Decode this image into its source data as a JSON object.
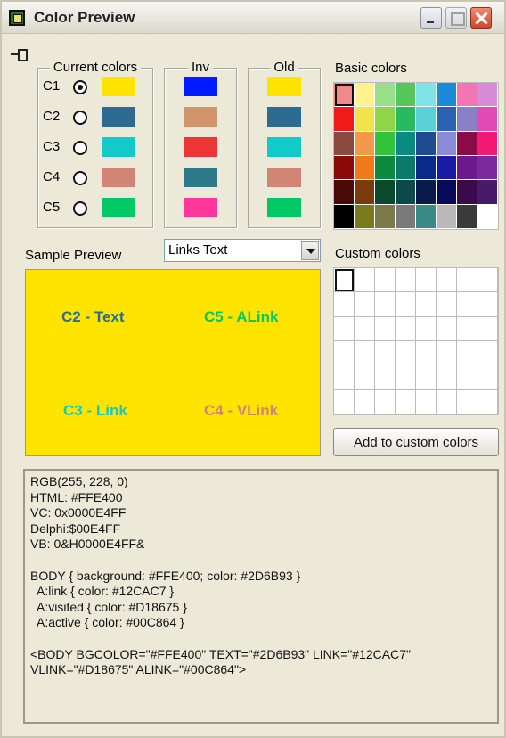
{
  "window": {
    "title": "Color Preview"
  },
  "current_colors": {
    "legend": "Current colors",
    "rows": [
      {
        "label": "C1",
        "selected": true,
        "color": "#FFE400"
      },
      {
        "label": "C2",
        "selected": false,
        "color": "#2D6B93"
      },
      {
        "label": "C3",
        "selected": false,
        "color": "#12CAC7"
      },
      {
        "label": "C4",
        "selected": false,
        "color": "#D18675"
      },
      {
        "label": "C5",
        "selected": false,
        "color": "#00C864"
      }
    ]
  },
  "inv_colors": {
    "legend": "Inv",
    "colors": [
      "#001BFF",
      "#D2946C",
      "#ED3538",
      "#2E798A",
      "#FF379B"
    ]
  },
  "old_colors": {
    "legend": "Old",
    "colors": [
      "#FFE400",
      "#2D6B93",
      "#12CAC7",
      "#D18675",
      "#00C864"
    ]
  },
  "basic_colors": {
    "label": "Basic colors",
    "colors": [
      "#F08A8A",
      "#FFF38F",
      "#98E08A",
      "#54C65A",
      "#7FE3E8",
      "#1B8AD8",
      "#F276B4",
      "#D98BD8",
      "#F01A1A",
      "#F3E34A",
      "#8CD648",
      "#29B95E",
      "#5AD0D8",
      "#2A61B4",
      "#8A80C6",
      "#E24AB6",
      "#8A4A40",
      "#F39A4A",
      "#33C33A",
      "#0A8A82",
      "#1F4A8F",
      "#8A8AD8",
      "#8A0A4A",
      "#F21A72",
      "#8A0A0A",
      "#F07A1A",
      "#0A8A3A",
      "#0A7A6A",
      "#0A2A8A",
      "#1A1AA8",
      "#6A1A8A",
      "#7A2A9A",
      "#4A0A0A",
      "#7A3A0A",
      "#0A4A2A",
      "#0A4A4A",
      "#0A1A4A",
      "#0A0A5A",
      "#3A0A4A",
      "#4A1A6A",
      "#000000",
      "#7A7A1A",
      "#7A7A4A",
      "#7A7A7A",
      "#3A8A8A",
      "#B9B9B9",
      "#3A3A3A",
      "#FFFFFF"
    ],
    "selected_index": 0
  },
  "custom_colors": {
    "label": "Custom colors",
    "selected_index": 0,
    "add_button": "Add to custom colors"
  },
  "sample_preview": {
    "label": "Sample Preview",
    "dropdown_value": "Links Text",
    "background": "#FFE400",
    "items": {
      "text": {
        "label": "C2 - Text",
        "color": "#2D6B93"
      },
      "alink": {
        "label": "C5 - ALink",
        "color": "#00C864"
      },
      "link": {
        "label": "C3 - Link",
        "color": "#12CAC7"
      },
      "vlink": {
        "label": "C4 - VLink",
        "color": "#D18675"
      }
    }
  },
  "output": {
    "lines": [
      "RGB(255, 228, 0)",
      "HTML: #FFE400",
      "VC: 0x0000E4FF",
      "Delphi:$00E4FF",
      "VB: 0&H0000E4FF&",
      "",
      "BODY { background: #FFE400; color: #2D6B93 }",
      "  A:link { color: #12CAC7 }",
      "  A:visited { color: #D18675 }",
      "  A:active { color: #00C864 }",
      "",
      "<BODY BGCOLOR=\"#FFE400\" TEXT=\"#2D6B93\" LINK=\"#12CAC7\"",
      "VLINK=\"#D18675\" ALINK=\"#00C864\">"
    ]
  }
}
